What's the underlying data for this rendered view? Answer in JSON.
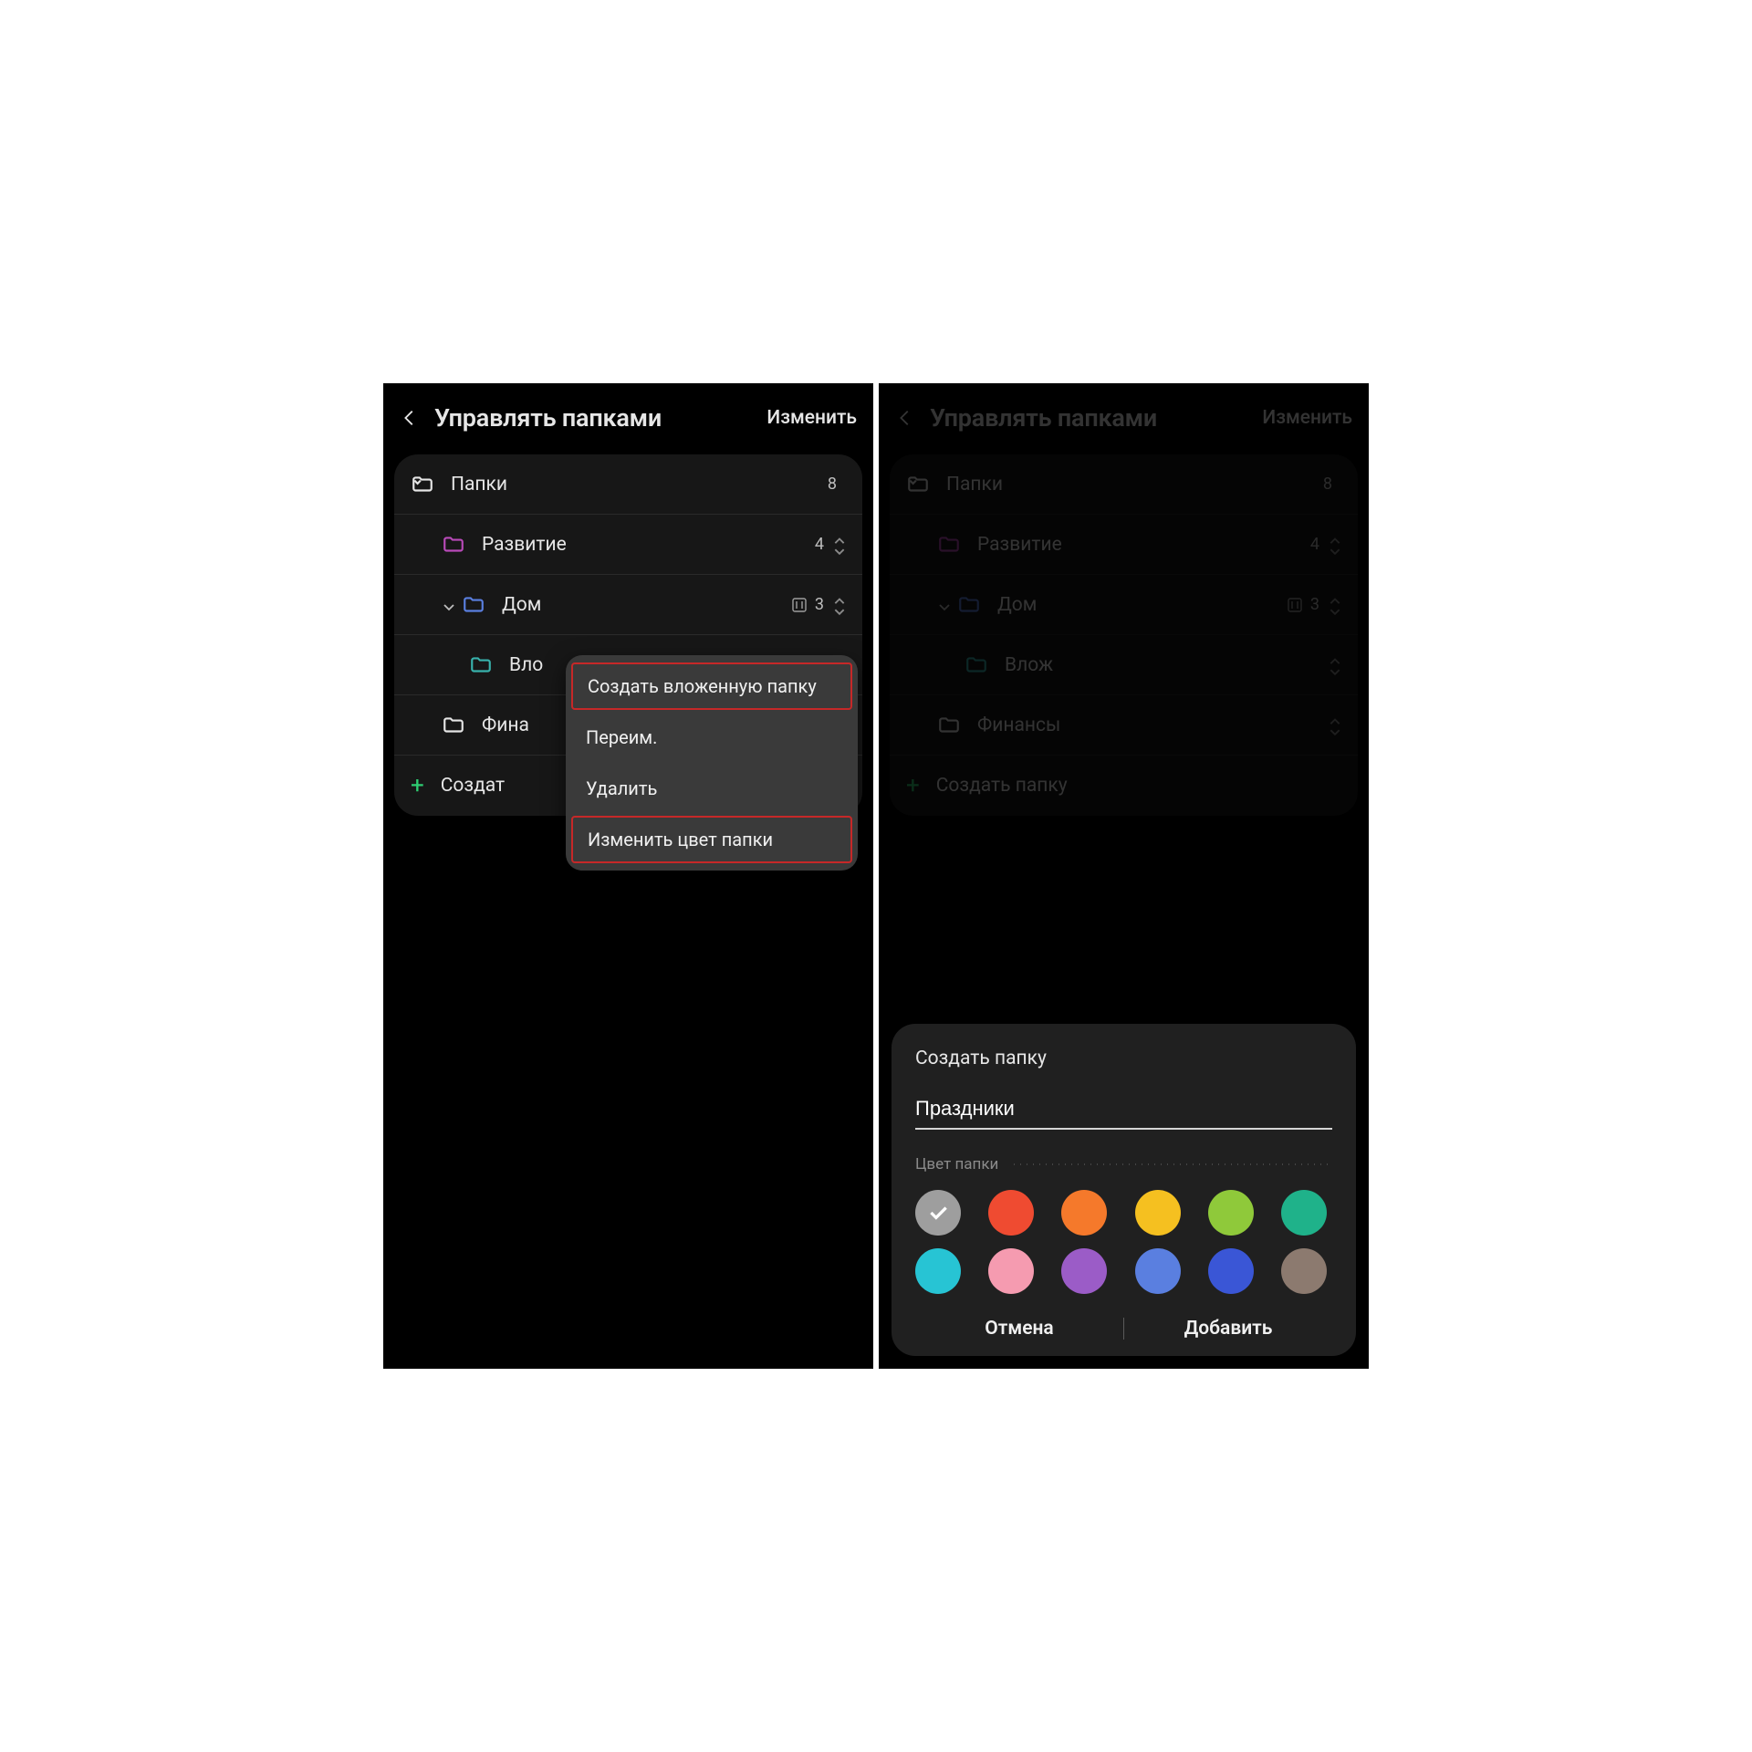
{
  "left": {
    "header": {
      "title": "Управлять папками",
      "edit": "Изменить"
    },
    "rows": {
      "root": {
        "label": "Папки",
        "count": "8"
      },
      "dev": {
        "label": "Развитие",
        "count": "4"
      },
      "home": {
        "label": "Дом",
        "count": "3"
      },
      "sub": {
        "label": "Вло"
      },
      "fin": {
        "label": "Фина"
      },
      "create": {
        "label": "Создат"
      }
    },
    "ctx": {
      "create_sub": "Создать вложенную папку",
      "rename": "Переим.",
      "delete": "Удалить",
      "recolor": "Изменить цвет папки"
    }
  },
  "right": {
    "header": {
      "title": "Управлять папками",
      "edit": "Изменить"
    },
    "rows": {
      "root": {
        "label": "Папки",
        "count": "8"
      },
      "dev": {
        "label": "Развитие",
        "count": "4"
      },
      "home": {
        "label": "Дом",
        "count": "3"
      },
      "sub": {
        "label": "Влож"
      },
      "fin": {
        "label": "Финансы"
      },
      "create": {
        "label": "Создать папку"
      }
    },
    "sheet": {
      "title": "Создать папку",
      "value": "Праздники",
      "section": "Цвет папки",
      "cancel": "Отмена",
      "add": "Добавить",
      "colors": [
        "#9e9e9e",
        "#ef4b31",
        "#f5792b",
        "#f5c020",
        "#8fc93a",
        "#1fb28a",
        "#27c4d4",
        "#f59bb0",
        "#9b5cc7",
        "#5a7fe0",
        "#3a56d6",
        "#8c7a6f"
      ]
    }
  }
}
